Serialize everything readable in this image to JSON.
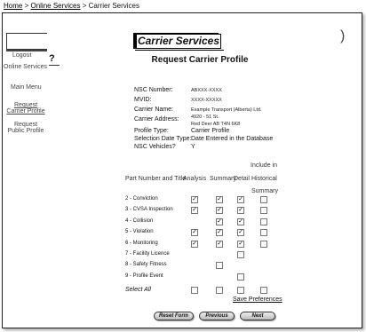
{
  "breadcrumb": {
    "home": "Home",
    "sep1": ">",
    "online": "Online Services",
    "sep2": ">",
    "current": "Carrier Services"
  },
  "sidebar": {
    "logout": "Logout",
    "online_services": "Online Services",
    "help": "?",
    "main_menu": "Main Menu",
    "request_carrier_profile": [
      "Request",
      "Carrier Profile"
    ],
    "request_public_profile": [
      "Request",
      "Public Profile"
    ]
  },
  "banner": {
    "title": "Carrier Services"
  },
  "page": {
    "heading": "Request Carrier Profile"
  },
  "info": {
    "nsc_label": "NSC Number:",
    "nsc_value": "ABXXX-XXXX",
    "mvid_label": "MVID:",
    "mvid_value": "XXXX-XXXXX",
    "name_label": "Carrier Name:",
    "name_value": "Example Transport (Alberta) Ltd.",
    "address_label": "Carrier Address:",
    "address_line1": "4920 - 51 St.",
    "address_line2": "Red Deer AB T4N 6K8",
    "profile_type_label": "Profile Type:",
    "profile_type_value": "Carrier Profile",
    "selection_label": "Selection Date Type:",
    "selection_value": "Date Entered in the Database",
    "vehicles_label": "NSC Vehicles?",
    "vehicles_value": "Y"
  },
  "table": {
    "col_part": "Part Number and Title",
    "col_analysis": "Analysis",
    "col_summary": "Summary",
    "col_detail": "Detail",
    "col_include": "Include in",
    "col_historical": "Historical",
    "col_summary2": "Summary",
    "rows": [
      {
        "label": "2 - Conviction",
        "checks": [
          "x",
          "x",
          "x",
          "o"
        ]
      },
      {
        "label": "3 - CVSA Inspection",
        "checks": [
          "x",
          "x",
          "x",
          "o"
        ]
      },
      {
        "label": "4 - Collision",
        "checks": [
          "-",
          "x",
          "x",
          "o"
        ]
      },
      {
        "label": "5 - Violation",
        "checks": [
          "x",
          "x",
          "x",
          "o"
        ]
      },
      {
        "label": "6 - Monitoring",
        "checks": [
          "x",
          "x",
          "x",
          "o"
        ]
      },
      {
        "label": "7 - Facility Licence",
        "checks": [
          "-",
          "-",
          "o",
          "-"
        ]
      },
      {
        "label": "8 - Safety Fitness",
        "checks": [
          "-",
          "o",
          "-",
          "-"
        ]
      },
      {
        "label": "9 - Profile Event",
        "checks": [
          "-",
          "-",
          "o",
          "-"
        ]
      }
    ],
    "select_all": "Select All",
    "select_all_checks": [
      "o",
      "o",
      "o",
      "o"
    ],
    "save_preferences": "Save Preferences"
  },
  "buttons": {
    "reset": "Reset Form",
    "previous": "Previous",
    "next": "Next"
  }
}
